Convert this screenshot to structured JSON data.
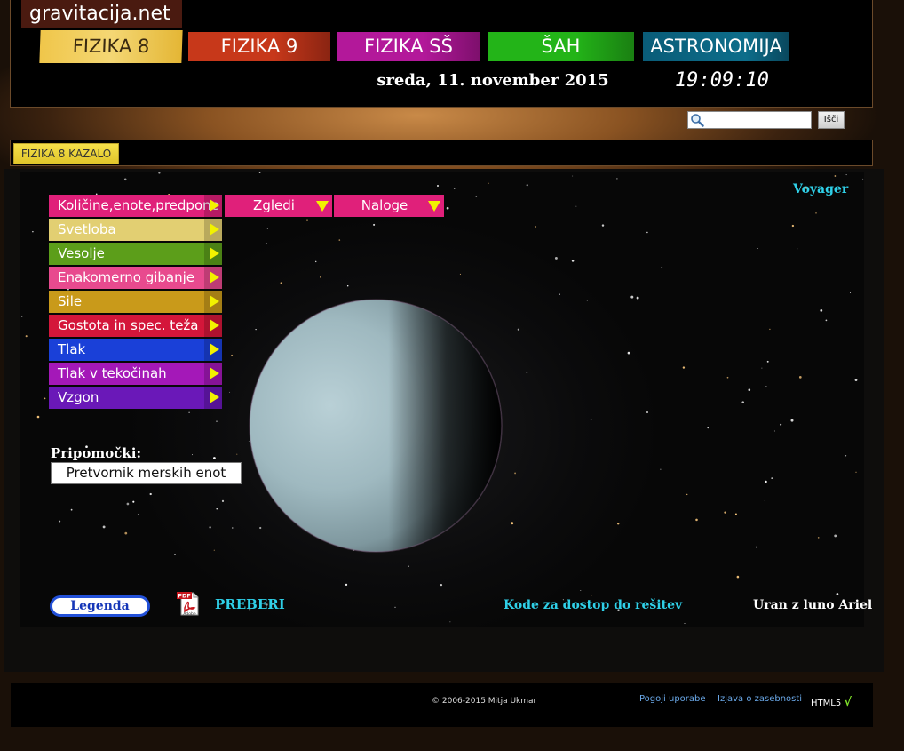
{
  "header": {
    "site_name": "gravitacija.net",
    "tabs": [
      {
        "label": "FIZIKA 8",
        "color": "#f0c64a"
      },
      {
        "label": "FIZIKA 9",
        "color": "#c7381a"
      },
      {
        "label": "FIZIKA SŠ",
        "color": "#b3189a"
      },
      {
        "label": "ŠAH",
        "color": "#23b418"
      },
      {
        "label": "ASTRONOMIJA",
        "color": "#0d6d8a"
      }
    ],
    "date": "sreda, 11. november 2015",
    "clock": "19:09:10"
  },
  "search": {
    "icon": "magnifier-icon",
    "value": "",
    "button_label": "Išči"
  },
  "kazalo": {
    "label": "FIZIKA 8 KAZALO"
  },
  "main": {
    "voyager": "Voyager",
    "menu": [
      {
        "label": "Količine,enote,predpone",
        "color": "#e0207a"
      },
      {
        "label": "Svetloba",
        "color": "#e2cf72"
      },
      {
        "label": "Vesolje",
        "color": "#5c9e1a"
      },
      {
        "label": "Enakomerno gibanje",
        "color": "#e84a8e"
      },
      {
        "label": "Sile",
        "color": "#c99a1a"
      },
      {
        "label": "Gostota in spec. teža",
        "color": "#d4163a"
      },
      {
        "label": "Tlak",
        "color": "#1a40d8"
      },
      {
        "label": "Tlak v tekočinah",
        "color": "#a418b8"
      },
      {
        "label": "Vzgon",
        "color": "#6a18b8"
      }
    ],
    "dropdowns": [
      {
        "label": "Zgledi",
        "color": "#e0207a"
      },
      {
        "label": "Naloge",
        "color": "#e0207a"
      }
    ],
    "tools_title": "Pripomočki:",
    "converter_button": "Pretvornik merskih enot",
    "legend_button": "Legenda",
    "pdf_icon": "pdf-adobe-icon",
    "preberi": "PREBERI",
    "codes_link": "Kode za dostop do rešitev",
    "caption": "Uran z luno Ariel"
  },
  "footer": {
    "copyright": "© 2006-2015  Mitja Ukmar",
    "terms": "Pogoji uporabe",
    "privacy": "Izjava o zasebnosti",
    "html5": "HTML5",
    "html5_check": "√"
  }
}
